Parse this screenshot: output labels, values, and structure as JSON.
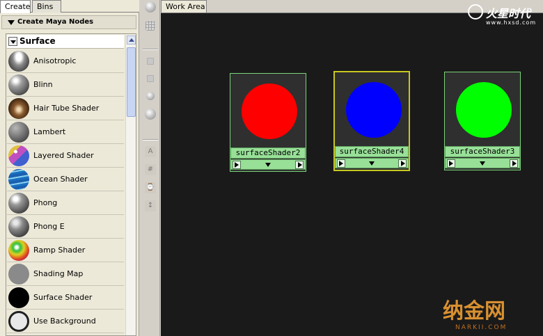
{
  "tabs": {
    "create": "Create",
    "bins": "Bins"
  },
  "section": {
    "title": "Create Maya Nodes"
  },
  "category": {
    "label": "Surface"
  },
  "items": [
    {
      "label": "Anisotropic",
      "icon": "anisotropic-icon"
    },
    {
      "label": "Blinn",
      "icon": "blinn-icon"
    },
    {
      "label": "Hair Tube Shader",
      "icon": "hair-tube-shader-icon"
    },
    {
      "label": "Lambert",
      "icon": "lambert-icon"
    },
    {
      "label": "Layered Shader",
      "icon": "layered-shader-icon"
    },
    {
      "label": "Ocean Shader",
      "icon": "ocean-shader-icon"
    },
    {
      "label": "Phong",
      "icon": "phong-icon"
    },
    {
      "label": "Phong E",
      "icon": "phong-e-icon"
    },
    {
      "label": "Ramp Shader",
      "icon": "ramp-shader-icon"
    },
    {
      "label": "Shading Map",
      "icon": "shading-map-icon"
    },
    {
      "label": "Surface Shader",
      "icon": "surface-shader-icon"
    },
    {
      "label": "Use Background",
      "icon": "use-background-icon"
    }
  ],
  "work_area": {
    "tab_label": "Work Area",
    "nodes": [
      {
        "name": "surfaceShader2",
        "color": "#ff0000",
        "selected": false
      },
      {
        "name": "surfaceShader4",
        "color": "#0000ff",
        "selected": true
      },
      {
        "name": "surfaceShader3",
        "color": "#00ff00",
        "selected": false
      }
    ]
  },
  "watermarks": {
    "top_name": "火星时代",
    "top_url": "www.hxsd.com",
    "bottom_name": "纳金网",
    "bottom_url": "NARKII.COM"
  },
  "colors": {
    "work_area_bg": "#1a1a1a",
    "node_label_bg": "#98e098",
    "selected_border": "#c8c820"
  }
}
